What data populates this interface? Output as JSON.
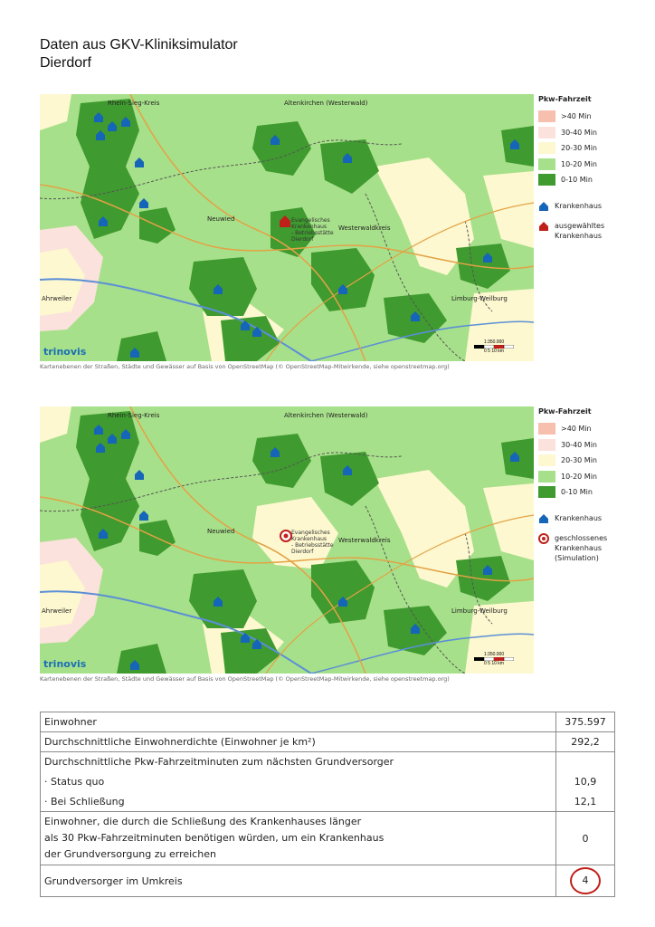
{
  "header": {
    "line1": "Daten aus GKV-Kliniksimulator",
    "line2": "Dierdorf"
  },
  "map_credit": "Kartenebenen der Straßen, Städte und Gewässer auf Basis von OpenStreetMap (© OpenStreetMap-Mitwirkende, siehe openstreetmap.org)",
  "logo": "trinovis",
  "scale": {
    "label": "1:350.000",
    "ticks": "0 5 10 km"
  },
  "legend": {
    "title": "Pkw-Fahrzeit",
    "classes": [
      {
        "label": ">40 Min",
        "color": "#f7bfae"
      },
      {
        "label": "30-40 Min",
        "color": "#fbe2dc"
      },
      {
        "label": "20-30 Min",
        "color": "#fdf8d0"
      },
      {
        "label": "10-20 Min",
        "color": "#a7e08a"
      },
      {
        "label": "0-10 Min",
        "color": "#3f9a2f"
      }
    ],
    "hospital": "Krankenhaus",
    "selected": "ausgewähltes Krankenhaus",
    "closed": "geschlossenes Krankenhaus (Simulation)"
  },
  "map_labels": {
    "regions": [
      "Rhein-Sieg-Kreis",
      "Altenkirchen (Westerwald)",
      "Neuwied",
      "Westerwaldkreis",
      "Limburg-Weilburg",
      "Ahrweiler"
    ],
    "hospital_name": "Evangelisches Krankenhaus - Betriebsstätte Dierdorf"
  },
  "table": {
    "residents_label": "Einwohner",
    "residents_value": "375.597",
    "density_label": "Durchschnittliche Einwohnerdichte (Einwohner je km²)",
    "density_value": "292,2",
    "drive_label": "Durchschnittliche Pkw-Fahrzeitminuten zum nächsten Grundversorger",
    "status_label": "· Status quo",
    "status_value": "10,9",
    "closure_label": "· Bei Schließung",
    "closure_value": "12,1",
    "longer_label_1": "Einwohner, die durch die Schließung des Krankenhauses länger",
    "longer_label_2": "als 30 Pkw-Fahrzeitminuten benötigen würden, um ein Krankenhaus",
    "longer_label_3": "der Grundversorgung zu erreichen",
    "longer_value": "0",
    "radius_label": "Grundversorger im Umkreis",
    "radius_value": "4"
  }
}
